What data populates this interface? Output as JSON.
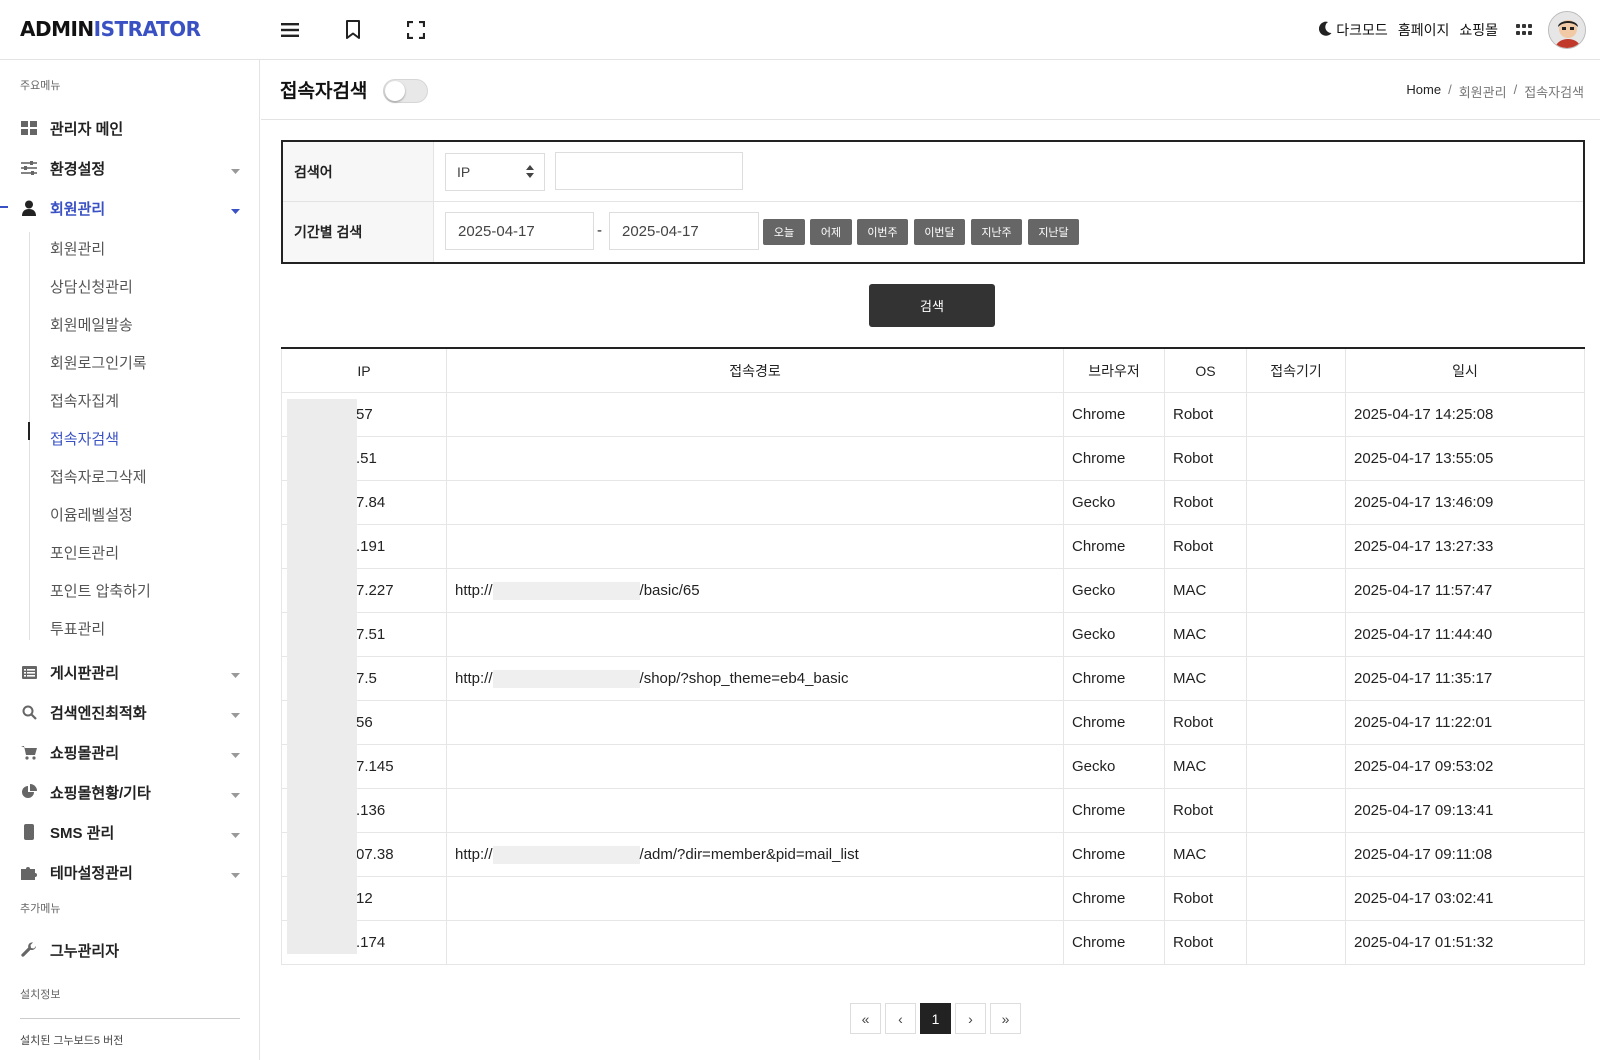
{
  "header": {
    "logo_part1": "ADMIN",
    "logo_part2": "ISTRATOR",
    "dark_mode": "다크모드",
    "homepage": "홈페이지",
    "shop": "쇼핑몰"
  },
  "sidebar": {
    "main_section": "주요메뉴",
    "items": [
      {
        "label": "관리자 메인",
        "icon": "dashboard-icon"
      },
      {
        "label": "환경설정",
        "icon": "sliders-icon"
      },
      {
        "label": "회원관리",
        "icon": "user-icon"
      },
      {
        "label": "게시판관리",
        "icon": "list-icon"
      },
      {
        "label": "검색엔진최적화",
        "icon": "search-icon"
      },
      {
        "label": "쇼핑몰관리",
        "icon": "cart-icon"
      },
      {
        "label": "쇼핑몰현황/기타",
        "icon": "pie-chart-icon"
      },
      {
        "label": "SMS 관리",
        "icon": "mobile-icon"
      },
      {
        "label": "테마설정관리",
        "icon": "puzzle-icon"
      }
    ],
    "submenu": [
      "회원관리",
      "상담신청관리",
      "회원메일발송",
      "회원로그인기록",
      "접속자집계",
      "접속자검색",
      "접속자로그삭제",
      "이윰레벨설정",
      "포인트관리",
      "포인트 압축하기",
      "투표관리"
    ],
    "extra_section": "추가메뉴",
    "extra_item": "그누관리자",
    "install_section": "설치정보",
    "install_text": "설치된 그누보드5 버전"
  },
  "page": {
    "title": "접속자검색",
    "breadcrumb": [
      "Home",
      "/",
      "회원관리",
      "/",
      "접속자검색"
    ]
  },
  "search": {
    "keyword_label": "검색어",
    "select_value": "IP",
    "keyword_value": "",
    "period_label": "기간별 검색",
    "date_from": "2025-04-17",
    "date_sep": "-",
    "date_to": "2025-04-17",
    "quick_buttons": [
      "오늘",
      "어제",
      "이번주",
      "이번달",
      "지난주",
      "지난달"
    ],
    "submit": "검색"
  },
  "table": {
    "headers": [
      "IP",
      "접속경로",
      "브라우저",
      "OS",
      "접속기기",
      "일시"
    ],
    "rows": [
      {
        "ip": "57",
        "ref_prefix": "",
        "ref_suffix": "",
        "browser": "Chrome",
        "os": "Robot",
        "device": "",
        "datetime": "2025-04-17 14:25:08"
      },
      {
        "ip": ".51",
        "ref_prefix": "",
        "ref_suffix": "",
        "browser": "Chrome",
        "os": "Robot",
        "device": "",
        "datetime": "2025-04-17 13:55:05"
      },
      {
        "ip": "7.84",
        "ref_prefix": "",
        "ref_suffix": "",
        "browser": "Gecko",
        "os": "Robot",
        "device": "",
        "datetime": "2025-04-17 13:46:09"
      },
      {
        "ip": ".191",
        "ref_prefix": "",
        "ref_suffix": "",
        "browser": "Chrome",
        "os": "Robot",
        "device": "",
        "datetime": "2025-04-17 13:27:33"
      },
      {
        "ip": "7.227",
        "ref_prefix": "http://",
        "ref_suffix": "/basic/65",
        "browser": "Gecko",
        "os": "MAC",
        "device": "",
        "datetime": "2025-04-17 11:57:47"
      },
      {
        "ip": "7.51",
        "ref_prefix": "",
        "ref_suffix": "",
        "browser": "Gecko",
        "os": "MAC",
        "device": "",
        "datetime": "2025-04-17 11:44:40"
      },
      {
        "ip": "7.5",
        "ref_prefix": "http://",
        "ref_suffix": "/shop/?shop_theme=eb4_basic",
        "browser": "Chrome",
        "os": "MAC",
        "device": "",
        "datetime": "2025-04-17 11:35:17"
      },
      {
        "ip": "56",
        "ref_prefix": "",
        "ref_suffix": "",
        "browser": "Chrome",
        "os": "Robot",
        "device": "",
        "datetime": "2025-04-17 11:22:01"
      },
      {
        "ip": "7.145",
        "ref_prefix": "",
        "ref_suffix": "",
        "browser": "Gecko",
        "os": "MAC",
        "device": "",
        "datetime": "2025-04-17 09:53:02"
      },
      {
        "ip": ".136",
        "ref_prefix": "",
        "ref_suffix": "",
        "browser": "Chrome",
        "os": "Robot",
        "device": "",
        "datetime": "2025-04-17 09:13:41"
      },
      {
        "ip": "07.38",
        "ref_prefix": "http://",
        "ref_suffix": "/adm/?dir=member&pid=mail_list",
        "browser": "Chrome",
        "os": "MAC",
        "device": "",
        "datetime": "2025-04-17 09:11:08"
      },
      {
        "ip": "12",
        "ref_prefix": "",
        "ref_suffix": "",
        "browser": "Chrome",
        "os": "Robot",
        "device": "",
        "datetime": "2025-04-17 03:02:41"
      },
      {
        "ip": ".174",
        "ref_prefix": "",
        "ref_suffix": "",
        "browser": "Chrome",
        "os": "Robot",
        "device": "",
        "datetime": "2025-04-17 01:51:32"
      }
    ]
  },
  "pagination": {
    "first": "«",
    "prev": "‹",
    "current": "1",
    "next": "›",
    "last": "»"
  },
  "colors": {
    "accent": "#3a51c4",
    "dark": "#222222",
    "quick_button": "#666666"
  }
}
